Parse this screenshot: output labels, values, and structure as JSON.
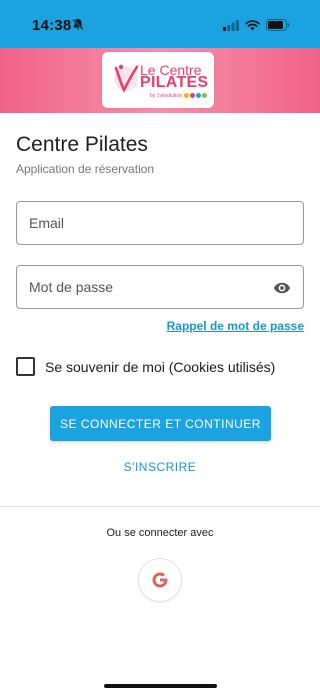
{
  "status_bar": {
    "time": "14:38",
    "icons": [
      "bell-off-icon",
      "signal-icon",
      "wifi-icon",
      "battery-icon"
    ],
    "background": "#1aa3e0"
  },
  "header": {
    "gradient_colors": [
      "#f06388",
      "#f590a8"
    ],
    "logo": {
      "line1": "Le Centre",
      "line2": "PILATES",
      "line3": "by 1vévolution",
      "brand_color": "#e83e6e"
    }
  },
  "app": {
    "title": "Centre Pilates",
    "subtitle": "Application de réservation"
  },
  "login_form": {
    "email_placeholder": "Email",
    "email_value": "",
    "password_placeholder": "Mot de passe",
    "password_value": "",
    "forgot_password_label": "Rappel de mot de passe",
    "remember_me_label": "Se souvenir de moi (Cookies utilisés)",
    "remember_me_checked": false,
    "connect_label": "SE CONNECTER ET CONTINUER",
    "signup_label": "S'INSCRIRE"
  },
  "social": {
    "label": "Ou se connecter avec",
    "providers": [
      "google-icon"
    ]
  },
  "colors": {
    "accent": "#1aa3e0",
    "link": "#1a94d3"
  }
}
